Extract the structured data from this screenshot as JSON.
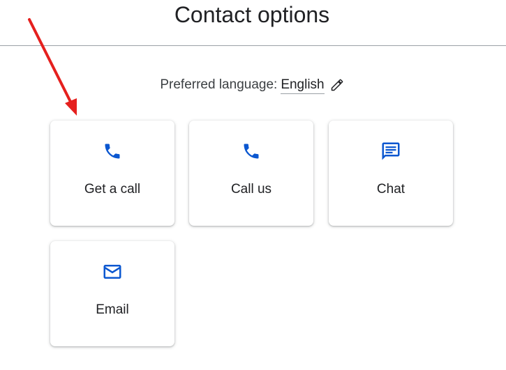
{
  "header": {
    "title": "Contact options"
  },
  "language": {
    "label": "Preferred language:",
    "value": "English",
    "edit_icon": "pencil-icon"
  },
  "options": [
    {
      "label": "Get a call",
      "icon": "phone-icon"
    },
    {
      "label": "Call us",
      "icon": "phone-icon"
    },
    {
      "label": "Chat",
      "icon": "chat-icon"
    },
    {
      "label": "Email",
      "icon": "mail-icon"
    }
  ],
  "colors": {
    "icon_blue": "#0b57d0",
    "annotation_red": "#e5201e"
  }
}
